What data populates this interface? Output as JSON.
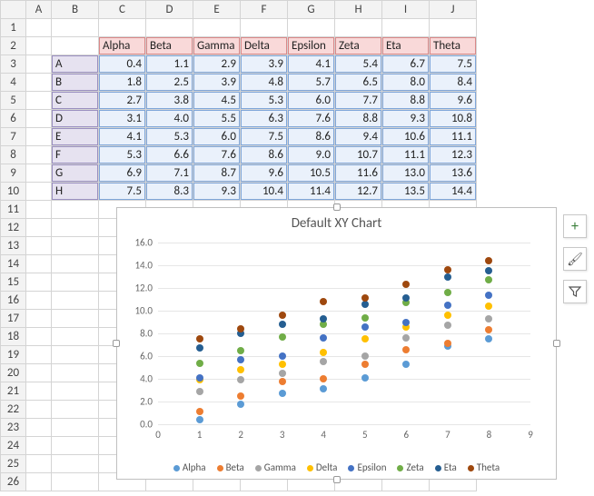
{
  "columns": [
    "A",
    "B",
    "C",
    "D",
    "E",
    "F",
    "G",
    "H",
    "I",
    "J"
  ],
  "row_numbers": [
    1,
    2,
    3,
    4,
    5,
    6,
    7,
    8,
    9,
    10,
    11,
    12,
    13,
    14,
    15,
    16,
    17,
    18,
    19,
    20,
    21,
    22,
    23,
    24,
    25,
    26
  ],
  "headers": [
    "Alpha",
    "Beta",
    "Gamma",
    "Delta",
    "Epsilon",
    "Zeta",
    "Eta",
    "Theta"
  ],
  "row_labels": [
    "A",
    "B",
    "C",
    "D",
    "E",
    "F",
    "G",
    "H"
  ],
  "data_rows": [
    [
      "0.4",
      "1.1",
      "2.9",
      "3.9",
      "4.1",
      "5.4",
      "6.7",
      "7.5"
    ],
    [
      "1.8",
      "2.5",
      "3.9",
      "4.8",
      "5.7",
      "6.5",
      "8.0",
      "8.4"
    ],
    [
      "2.7",
      "3.8",
      "4.5",
      "5.3",
      "6.0",
      "7.7",
      "8.8",
      "9.6"
    ],
    [
      "3.1",
      "4.0",
      "5.5",
      "6.3",
      "7.6",
      "8.8",
      "9.3",
      "10.8"
    ],
    [
      "4.1",
      "5.3",
      "6.0",
      "7.5",
      "8.6",
      "9.4",
      "10.6",
      "11.1"
    ],
    [
      "5.3",
      "6.6",
      "7.6",
      "8.6",
      "9.0",
      "10.7",
      "11.1",
      "12.3"
    ],
    [
      "6.9",
      "7.1",
      "8.7",
      "9.6",
      "10.5",
      "11.6",
      "13.0",
      "13.6"
    ],
    [
      "7.5",
      "8.3",
      "9.3",
      "10.4",
      "11.4",
      "12.7",
      "13.5",
      "14.4"
    ]
  ],
  "chart_data": {
    "type": "scatter",
    "title": "Default XY Chart",
    "xlabel": "",
    "ylabel": "",
    "xlim": [
      0,
      9
    ],
    "ylim": [
      0,
      16
    ],
    "xticks": [
      0,
      1,
      2,
      3,
      4,
      5,
      6,
      7,
      8,
      9
    ],
    "yticks": [
      0,
      2,
      4,
      6,
      8,
      10,
      12,
      14,
      16
    ],
    "ytick_labels": [
      "0.0",
      "2.0",
      "4.0",
      "6.0",
      "8.0",
      "10.0",
      "12.0",
      "14.0",
      "16.0"
    ],
    "x": [
      1,
      2,
      3,
      4,
      5,
      6,
      7,
      8
    ],
    "series": [
      {
        "name": "Alpha",
        "color": "#5b9bd5",
        "values": [
          0.4,
          1.8,
          2.7,
          3.1,
          4.1,
          5.3,
          6.9,
          7.5
        ]
      },
      {
        "name": "Beta",
        "color": "#ed7d31",
        "values": [
          1.1,
          2.5,
          3.8,
          4.0,
          5.3,
          6.6,
          7.1,
          8.3
        ]
      },
      {
        "name": "Gamma",
        "color": "#a5a5a5",
        "values": [
          2.9,
          3.9,
          4.5,
          5.5,
          6.0,
          7.6,
          8.7,
          9.3
        ]
      },
      {
        "name": "Delta",
        "color": "#ffc000",
        "values": [
          3.9,
          4.8,
          5.3,
          6.3,
          7.5,
          8.6,
          9.6,
          10.4
        ]
      },
      {
        "name": "Epsilon",
        "color": "#4472c4",
        "values": [
          4.1,
          5.7,
          6.0,
          7.6,
          8.6,
          9.0,
          10.5,
          11.4
        ]
      },
      {
        "name": "Zeta",
        "color": "#70ad47",
        "values": [
          5.4,
          6.5,
          7.7,
          8.8,
          9.4,
          10.7,
          11.6,
          12.7
        ]
      },
      {
        "name": "Eta",
        "color": "#255e91",
        "values": [
          6.7,
          8.0,
          8.8,
          9.3,
          10.6,
          11.1,
          13.0,
          13.5
        ]
      },
      {
        "name": "Theta",
        "color": "#9e480e",
        "values": [
          7.5,
          8.4,
          9.6,
          10.8,
          11.1,
          12.3,
          13.6,
          14.4
        ]
      }
    ]
  },
  "side_buttons": {
    "plus": "+",
    "brush": "🖌",
    "filter": "▼"
  }
}
